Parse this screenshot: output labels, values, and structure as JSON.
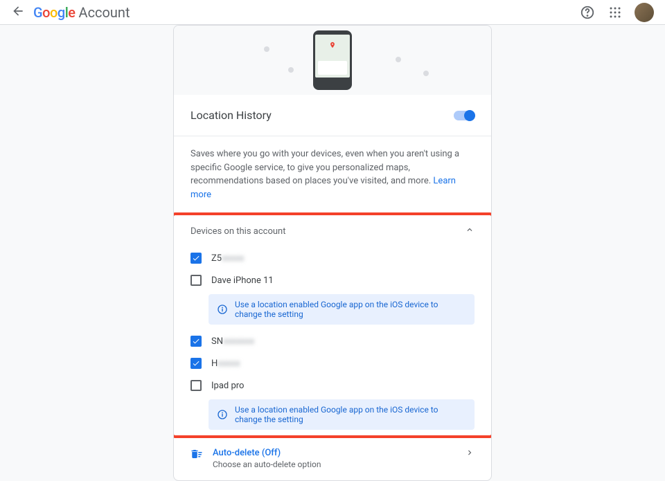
{
  "header": {
    "logo_google": "Google",
    "logo_account": "Account"
  },
  "card": {
    "section_title": "Location History",
    "toggle_on": true,
    "description": "Saves where you go with your devices, even when you aren't using a specific Google service, to give you personalized maps, recommendations based on places you've visited, and more.",
    "learn_more": "Learn more",
    "devices_header": "Devices on this account",
    "devices": [
      {
        "name_prefix": "Z5",
        "name_blurred": "xxxxx",
        "checked": true,
        "ios_notice": false
      },
      {
        "name_prefix": "Dave iPhone 11",
        "name_blurred": "",
        "checked": false,
        "ios_notice": true
      },
      {
        "name_prefix": "SN",
        "name_blurred": "xxxxxxx",
        "checked": true,
        "ios_notice": false
      },
      {
        "name_prefix": "H",
        "name_blurred": "xxxxx",
        "checked": true,
        "ios_notice": false
      },
      {
        "name_prefix": "Ipad pro",
        "name_blurred": "",
        "checked": false,
        "ios_notice": true
      }
    ],
    "ios_notice_text": "Use a location enabled Google app on the iOS device to change the setting",
    "auto_delete_title": "Auto-delete (Off)",
    "auto_delete_sub": "Choose an auto-delete option"
  }
}
